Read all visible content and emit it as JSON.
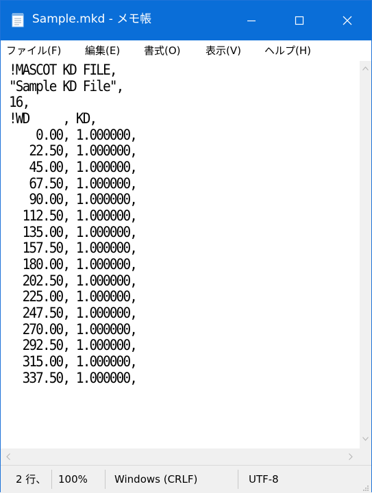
{
  "window": {
    "title": "Sample.mkd - メモ帳",
    "accent": "#0a6ed8",
    "icons": [
      "notepad-icon",
      "minimize-icon",
      "maximize-icon",
      "close-icon"
    ]
  },
  "menu": {
    "file": "ファイル(F)",
    "edit": "編集(E)",
    "format": "書式(O)",
    "view": "表示(V)",
    "help": "ヘルプ(H)"
  },
  "document": {
    "lines": [
      "!MASCOT KD FILE,",
      "\"Sample KD File\",",
      "16,",
      "!WD     , KD,",
      "    0.00, 1.000000,",
      "   22.50, 1.000000,",
      "   45.00, 1.000000,",
      "   67.50, 1.000000,",
      "   90.00, 1.000000,",
      "  112.50, 1.000000,",
      "  135.00, 1.000000,",
      "  157.50, 1.000000,",
      "  180.00, 1.000000,",
      "  202.50, 1.000000,",
      "  225.00, 1.000000,",
      "  247.50, 1.000000,",
      "  270.00, 1.000000,",
      "  292.50, 1.000000,",
      "  315.00, 1.000000,",
      "  337.50, 1.000000,"
    ]
  },
  "status": {
    "position": "2 行、",
    "zoom": "100%",
    "line_ending": "Windows (CRLF)",
    "encoding": "UTF-8"
  }
}
